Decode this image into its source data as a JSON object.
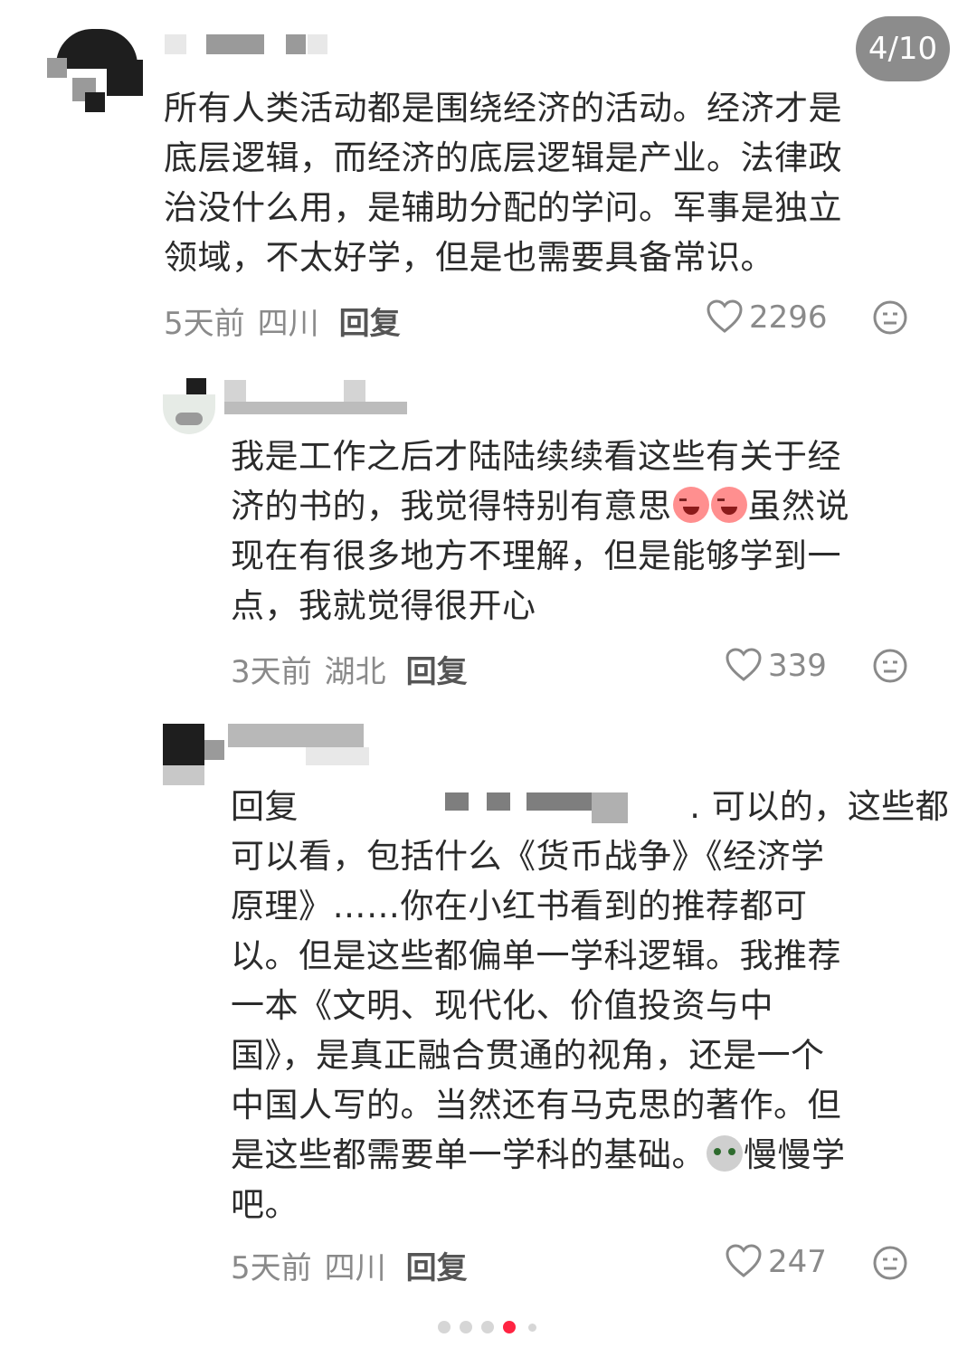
{
  "pager": {
    "counter": "4/10"
  },
  "comments": [
    {
      "lines": [
        "所有人类活动都是围绕经济的活动。经济才是",
        "底层逻辑，而经济的底层逻辑是产业。法律政",
        "治没什么用，是辅助分配的学问。军事是独立",
        "领域，不太好学，但是也需要具备常识。"
      ],
      "time": "5天前",
      "location": "四川",
      "reply_label": "回复",
      "likes": "2296"
    },
    {
      "line1": "我是工作之后才陆陆续续看这些有关于经",
      "line2_a": "济的书的，我觉得特别有意思",
      "line2_b": "虽然说",
      "line3": "现在有很多地方不理解，但是能够学到一",
      "line4": "点，我就觉得很开心",
      "emoji_name": "laughing-face-emoji",
      "time": "3天前",
      "location": "湖北",
      "reply_label": "回复",
      "likes": "339"
    },
    {
      "reply_prefix": "回复",
      "line1_tail": ". 可以的，这些都",
      "lines_mid": [
        "可以看，包括什么《货币战争》《经济学",
        "原理》……你在小红书看到的推荐都可",
        "以。但是这些都偏单一学科逻辑。我推荐",
        "一本《文明、现代化、价值投资与中",
        "国》，是真正融合贯通的视角，还是一个",
        "中国人写的。当然还有马克思的著作。但"
      ],
      "line_emoji_a": "是这些都需要单一学科的基础。",
      "line_emoji_b": "慢慢学",
      "line_last": "吧。",
      "emoji_name": "cat-face-emoji",
      "time": "5天前",
      "location": "四川",
      "reply_label": "回复",
      "likes": "247"
    }
  ],
  "carousel": {
    "active_index": 3,
    "count": 5
  },
  "colors": {
    "accent": "#ff2442",
    "counter_bg": "#8c8c8c",
    "text": "#2b2b2b",
    "meta": "#8a8a8a"
  }
}
